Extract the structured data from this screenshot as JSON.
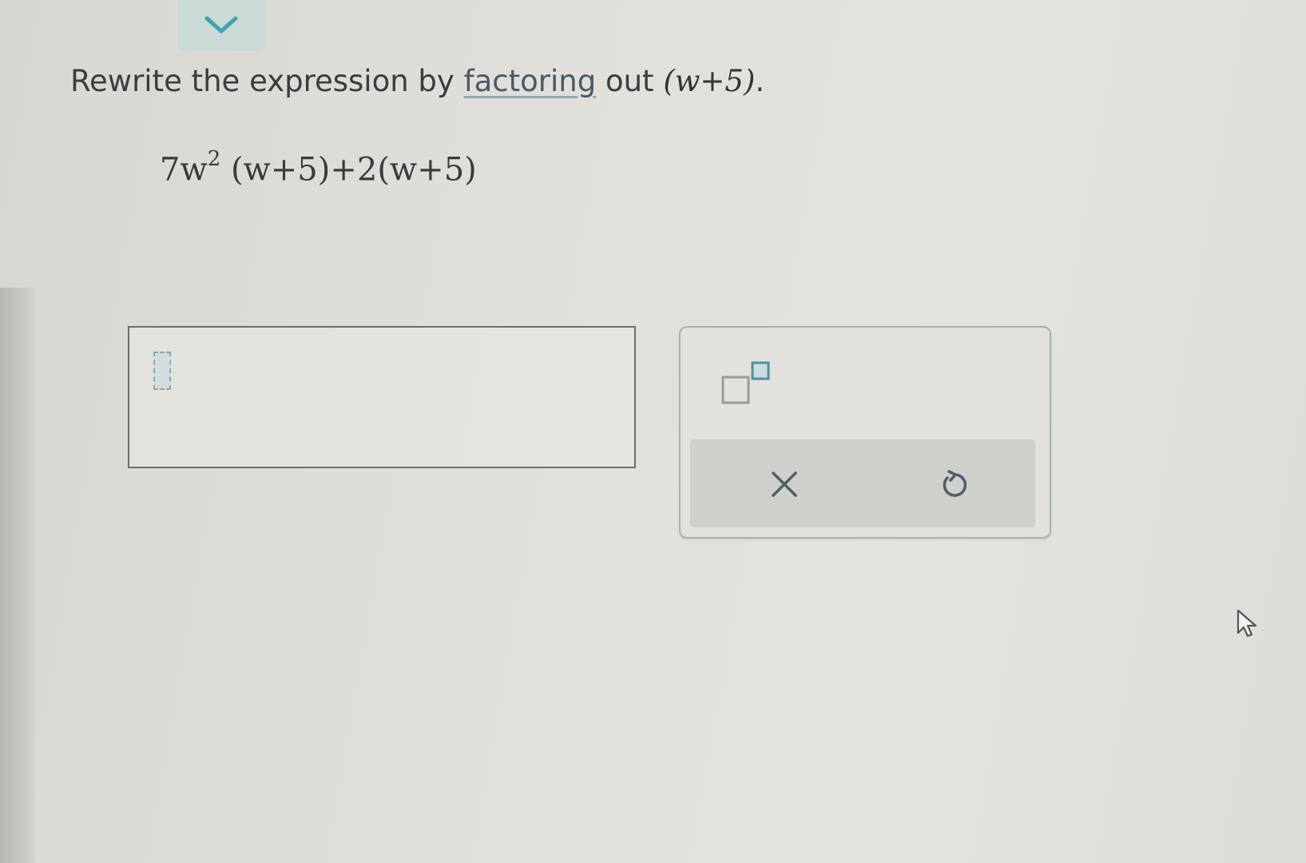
{
  "header": {
    "collapse_icon": "chevron-down-icon",
    "accent_color": "#3fa3ad"
  },
  "question": {
    "prompt_prefix": "Rewrite the expression by ",
    "prompt_link": "factoring",
    "prompt_middle": " out ",
    "prompt_factor": "(w+5)",
    "prompt_suffix": ".",
    "expression": {
      "coef": "7w",
      "exponent": "2",
      "rest": " (w+5)+2(w+5)"
    }
  },
  "answer": {
    "value": ""
  },
  "toolbar": {
    "superscript_icon": "superscript-template-icon",
    "clear_icon": "close-icon",
    "undo_icon": "undo-icon"
  }
}
